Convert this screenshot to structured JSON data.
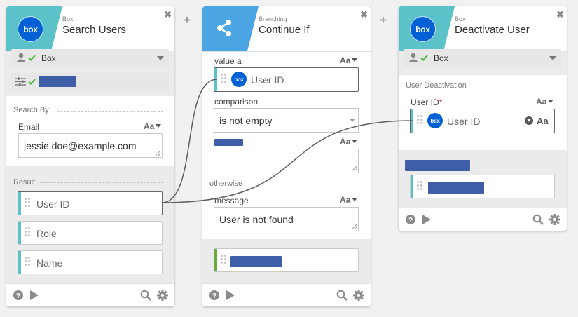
{
  "colors": {
    "box_band": "#5bc2c9",
    "branch_band": "#4ba5e3",
    "accent_bar": "#5bc2c9",
    "green_bar": "#6aaa3a",
    "box_blue": "#0061d5",
    "redaction": "#3f5ea8"
  },
  "add_icon": "plus-icon",
  "cards": {
    "search": {
      "category": "Box",
      "title": "Search Users",
      "close": "✖",
      "logo": "box",
      "connection": "Box",
      "search_by_label": "Search By",
      "email_label": "Email",
      "aa": "Aa",
      "email_value": "jessie.doe@example.com",
      "result_label": "Result",
      "result_items": [
        "User ID",
        "Role",
        "Name"
      ]
    },
    "branch": {
      "category": "Branching",
      "title": "Continue If",
      "close": "✖",
      "value_a_label": "value a",
      "aa": "Aa",
      "value_a_logo": "box",
      "value_a_pill": "User ID",
      "comparison_label": "comparison",
      "comparison_value": "is not empty",
      "otherwise_label": "otherwise",
      "message_label": "message",
      "message_value": "User is not found"
    },
    "deactivate": {
      "category": "Box",
      "title": "Deactivate User",
      "close": "✖",
      "logo": "box",
      "connection": "Box",
      "section_label": "User Deactivation",
      "user_id_label": "User ID",
      "required": "*",
      "aa": "Aa",
      "pill_logo": "box",
      "pill_text": "User ID",
      "clear": "✖",
      "pill_aa": "Aa"
    }
  }
}
